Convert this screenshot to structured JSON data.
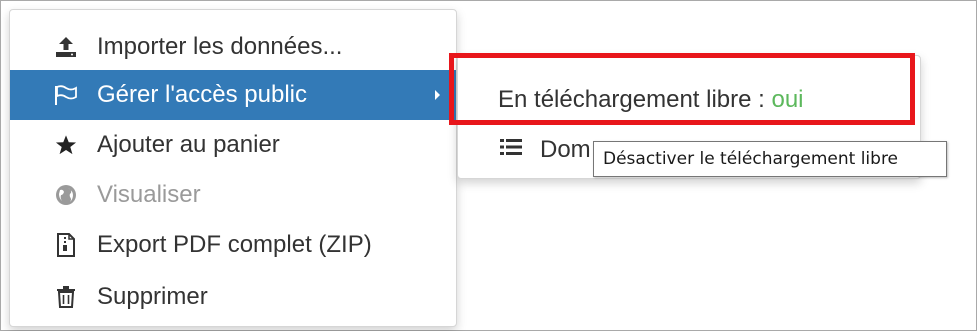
{
  "menu": {
    "items": [
      {
        "label": "Importer les données...",
        "icon": "upload-icon"
      },
      {
        "label": "Gérer l'accès public",
        "icon": "flag-icon",
        "state": "active"
      },
      {
        "label": "Ajouter au panier",
        "icon": "star-icon"
      },
      {
        "label": "Visualiser",
        "icon": "globe-icon",
        "state": "disabled"
      },
      {
        "label": "Export PDF complet (ZIP)",
        "icon": "zip-file-icon"
      },
      {
        "label": "Supprimer",
        "icon": "trash-icon"
      }
    ]
  },
  "submenu": {
    "free_download": {
      "label": "En téléchargement libre : ",
      "value": "oui"
    },
    "second_item": {
      "label": "Dom",
      "icon": "list-icon"
    }
  },
  "tooltip": {
    "text": "Désactiver le téléchargement libre"
  },
  "colors": {
    "active_bg": "#337ab7",
    "value_green": "#5cb85c",
    "highlight_red": "#e8161b"
  }
}
